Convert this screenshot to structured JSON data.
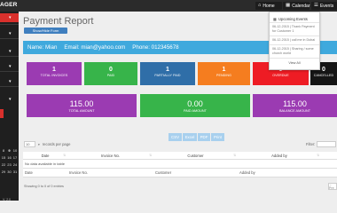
{
  "app": {
    "brand": "AGER"
  },
  "topnav": {
    "home_label": "Home",
    "calendar_label": "Calendar",
    "events_label": "Events"
  },
  "page": {
    "title": "Payment Report",
    "toggle_button_label": "Show/Hide Form"
  },
  "events_dropdown": {
    "header": "Upcoming Events",
    "items": [
      "06-12-2015 | Thank Payment for Customer 1",
      "06-12-2015 | call me in Dubai",
      "06-12-2015 | Sharing / some church world"
    ],
    "footer": "View All"
  },
  "customer": {
    "name_label": "Name:",
    "name_value": "Mian",
    "email_label": "Email:",
    "email_value": "mian@yahoo.com",
    "phone_label": "Phone:",
    "phone_value": "012345678"
  },
  "stats": [
    {
      "value": "1",
      "label": "TOTAL INVOICES",
      "color": "#9b3bb2"
    },
    {
      "value": "0",
      "label": "PAID",
      "color": "#37b44a"
    },
    {
      "value": "1",
      "label": "PARTIALLY PAID",
      "color": "#2f6ea8"
    },
    {
      "value": "1",
      "label": "PENDING",
      "color": "#f57d1f"
    },
    {
      "value": "0",
      "label": "OVERDUE",
      "color": "#ee1c24"
    },
    {
      "value": "0",
      "label": "CANCELLED",
      "color": "#151515"
    }
  ],
  "amounts": [
    {
      "value": "115.00",
      "label": "TOTAL AMOUNT",
      "color": "#9b3bb2"
    },
    {
      "value": "0.00",
      "label": "PAID AMOUNT",
      "color": "#37b44a"
    },
    {
      "value": "115.00",
      "label": "BALANCE AMOUNT",
      "color": "#9b3bb2"
    }
  ],
  "export_buttons": {
    "csv": "CSV",
    "excel": "Excel",
    "pdf": "PDF",
    "print": "Print"
  },
  "table": {
    "length_value": "10",
    "length_suffix": "records per page",
    "filter_label": "Filter:",
    "columns": [
      "Date",
      "Invoice No.",
      "Customer",
      "Added by"
    ],
    "empty_message": "No data available in table",
    "footer_columns": [
      "Date",
      "Invoice No.",
      "Customer",
      "Added by"
    ],
    "info": "Showing 0 to 0 of 0 entries",
    "pager_label": "← Pre"
  },
  "sidebar": {
    "calendar_rows": [
      [
        "8",
        "9",
        "10"
      ],
      [
        "15",
        "16",
        "17"
      ],
      [
        "22",
        "23",
        "24"
      ],
      [
        "29",
        "30",
        "31"
      ]
    ],
    "version": "V. 2.0"
  },
  "colors": {
    "topbar": "#2b2b2b",
    "sidebar": "#1f1f1f",
    "accent_red": "#d9302c",
    "info_bar": "#3fa9dd",
    "export_button": "#a8d0ee"
  }
}
